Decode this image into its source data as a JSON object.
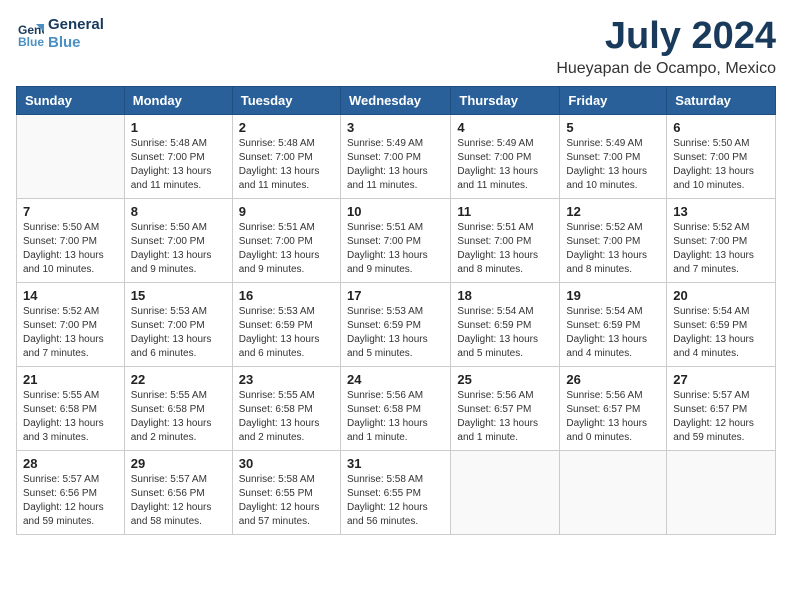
{
  "logo": {
    "line1": "General",
    "line2": "Blue"
  },
  "title": "July 2024",
  "location": "Hueyapan de Ocampo, Mexico",
  "headers": [
    "Sunday",
    "Monday",
    "Tuesday",
    "Wednesday",
    "Thursday",
    "Friday",
    "Saturday"
  ],
  "weeks": [
    [
      {
        "day": "",
        "info": ""
      },
      {
        "day": "1",
        "info": "Sunrise: 5:48 AM\nSunset: 7:00 PM\nDaylight: 13 hours\nand 11 minutes."
      },
      {
        "day": "2",
        "info": "Sunrise: 5:48 AM\nSunset: 7:00 PM\nDaylight: 13 hours\nand 11 minutes."
      },
      {
        "day": "3",
        "info": "Sunrise: 5:49 AM\nSunset: 7:00 PM\nDaylight: 13 hours\nand 11 minutes."
      },
      {
        "day": "4",
        "info": "Sunrise: 5:49 AM\nSunset: 7:00 PM\nDaylight: 13 hours\nand 11 minutes."
      },
      {
        "day": "5",
        "info": "Sunrise: 5:49 AM\nSunset: 7:00 PM\nDaylight: 13 hours\nand 10 minutes."
      },
      {
        "day": "6",
        "info": "Sunrise: 5:50 AM\nSunset: 7:00 PM\nDaylight: 13 hours\nand 10 minutes."
      }
    ],
    [
      {
        "day": "7",
        "info": "Sunrise: 5:50 AM\nSunset: 7:00 PM\nDaylight: 13 hours\nand 10 minutes."
      },
      {
        "day": "8",
        "info": "Sunrise: 5:50 AM\nSunset: 7:00 PM\nDaylight: 13 hours\nand 9 minutes."
      },
      {
        "day": "9",
        "info": "Sunrise: 5:51 AM\nSunset: 7:00 PM\nDaylight: 13 hours\nand 9 minutes."
      },
      {
        "day": "10",
        "info": "Sunrise: 5:51 AM\nSunset: 7:00 PM\nDaylight: 13 hours\nand 9 minutes."
      },
      {
        "day": "11",
        "info": "Sunrise: 5:51 AM\nSunset: 7:00 PM\nDaylight: 13 hours\nand 8 minutes."
      },
      {
        "day": "12",
        "info": "Sunrise: 5:52 AM\nSunset: 7:00 PM\nDaylight: 13 hours\nand 8 minutes."
      },
      {
        "day": "13",
        "info": "Sunrise: 5:52 AM\nSunset: 7:00 PM\nDaylight: 13 hours\nand 7 minutes."
      }
    ],
    [
      {
        "day": "14",
        "info": "Sunrise: 5:52 AM\nSunset: 7:00 PM\nDaylight: 13 hours\nand 7 minutes."
      },
      {
        "day": "15",
        "info": "Sunrise: 5:53 AM\nSunset: 7:00 PM\nDaylight: 13 hours\nand 6 minutes."
      },
      {
        "day": "16",
        "info": "Sunrise: 5:53 AM\nSunset: 6:59 PM\nDaylight: 13 hours\nand 6 minutes."
      },
      {
        "day": "17",
        "info": "Sunrise: 5:53 AM\nSunset: 6:59 PM\nDaylight: 13 hours\nand 5 minutes."
      },
      {
        "day": "18",
        "info": "Sunrise: 5:54 AM\nSunset: 6:59 PM\nDaylight: 13 hours\nand 5 minutes."
      },
      {
        "day": "19",
        "info": "Sunrise: 5:54 AM\nSunset: 6:59 PM\nDaylight: 13 hours\nand 4 minutes."
      },
      {
        "day": "20",
        "info": "Sunrise: 5:54 AM\nSunset: 6:59 PM\nDaylight: 13 hours\nand 4 minutes."
      }
    ],
    [
      {
        "day": "21",
        "info": "Sunrise: 5:55 AM\nSunset: 6:58 PM\nDaylight: 13 hours\nand 3 minutes."
      },
      {
        "day": "22",
        "info": "Sunrise: 5:55 AM\nSunset: 6:58 PM\nDaylight: 13 hours\nand 2 minutes."
      },
      {
        "day": "23",
        "info": "Sunrise: 5:55 AM\nSunset: 6:58 PM\nDaylight: 13 hours\nand 2 minutes."
      },
      {
        "day": "24",
        "info": "Sunrise: 5:56 AM\nSunset: 6:58 PM\nDaylight: 13 hours\nand 1 minute."
      },
      {
        "day": "25",
        "info": "Sunrise: 5:56 AM\nSunset: 6:57 PM\nDaylight: 13 hours\nand 1 minute."
      },
      {
        "day": "26",
        "info": "Sunrise: 5:56 AM\nSunset: 6:57 PM\nDaylight: 13 hours\nand 0 minutes."
      },
      {
        "day": "27",
        "info": "Sunrise: 5:57 AM\nSunset: 6:57 PM\nDaylight: 12 hours\nand 59 minutes."
      }
    ],
    [
      {
        "day": "28",
        "info": "Sunrise: 5:57 AM\nSunset: 6:56 PM\nDaylight: 12 hours\nand 59 minutes."
      },
      {
        "day": "29",
        "info": "Sunrise: 5:57 AM\nSunset: 6:56 PM\nDaylight: 12 hours\nand 58 minutes."
      },
      {
        "day": "30",
        "info": "Sunrise: 5:58 AM\nSunset: 6:55 PM\nDaylight: 12 hours\nand 57 minutes."
      },
      {
        "day": "31",
        "info": "Sunrise: 5:58 AM\nSunset: 6:55 PM\nDaylight: 12 hours\nand 56 minutes."
      },
      {
        "day": "",
        "info": ""
      },
      {
        "day": "",
        "info": ""
      },
      {
        "day": "",
        "info": ""
      }
    ]
  ]
}
